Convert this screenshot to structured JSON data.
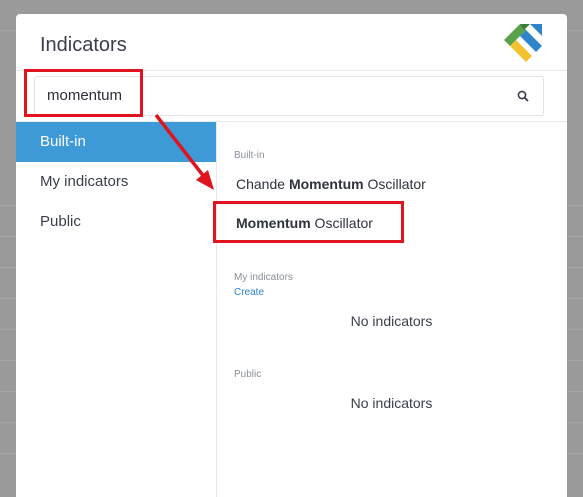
{
  "dialog": {
    "title": "Indicators"
  },
  "search": {
    "value": "momentum"
  },
  "sidebar": {
    "items": [
      {
        "label": "Built-in",
        "active": true
      },
      {
        "label": "My indicators",
        "active": false
      },
      {
        "label": "Public",
        "active": false
      }
    ]
  },
  "content": {
    "builtin": {
      "section_label": "Built-in",
      "item1": {
        "prefix": "Chande ",
        "highlight": "Momentum",
        "suffix": " Oscillator"
      },
      "item2": {
        "highlight": "Momentum",
        "suffix": " Oscillator"
      }
    },
    "my_indicators": {
      "section_label": "My indicators",
      "create_label": "Create",
      "empty_text": "No indicators"
    },
    "public": {
      "section_label": "Public",
      "empty_text": "No indicators"
    }
  },
  "colors": {
    "accent": "#3d9ad7",
    "annotation": "#e0141e",
    "link": "#2a84d2"
  },
  "icons": {
    "search": "magnifier-icon",
    "logo": "brand-logo"
  }
}
